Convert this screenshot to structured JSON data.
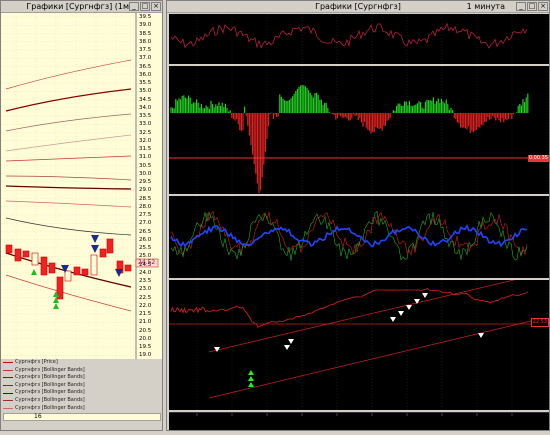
{
  "left_window": {
    "title": "Графики [Сургнфгз] (1м...",
    "price_axis": [
      "39.5",
      "39.0",
      "38.5",
      "38.0",
      "37.5",
      "37.0",
      "36.5",
      "36.0",
      "35.5",
      "35.0",
      "34.5",
      "34.0",
      "33.5",
      "33.0",
      "32.5",
      "32.0",
      "31.5",
      "31.0",
      "30.5",
      "30.0",
      "29.5",
      "29.0",
      "28.5",
      "28.0",
      "27.5",
      "27.0",
      "26.5",
      "26.0",
      "25.5",
      "25.0",
      "24.5",
      "24.0",
      "23.5",
      "23.0",
      "22.5",
      "22.0",
      "21.5",
      "21.0",
      "20.5",
      "20.0",
      "19.5",
      "19.0"
    ],
    "price_tag": "24.52",
    "legend": [
      {
        "text": "Сургнфгз [Price]",
        "color": "#cc0000"
      },
      {
        "text": "Сургнфгз [Bollinger Bands]",
        "color": "#cc3333"
      },
      {
        "text": "Сургнфгз [Bollinger Bands]",
        "color": "#990000"
      },
      {
        "text": "Сургнфгз [Bollinger Bands]",
        "color": "#cc0000"
      },
      {
        "text": "Сургнфгз [Bollinger Bands]",
        "color": "#660000"
      },
      {
        "text": "Сургнфгз [Bollinger Bands]",
        "color": "#993333"
      },
      {
        "text": "Сургнфгз [Bollinger Bands]",
        "color": "#cc6666"
      }
    ],
    "footer_value": "16"
  },
  "right_window": {
    "title": "Графики [Сургнфгз]",
    "timeframe": "1 минута",
    "panel2_tag": "0.00.35",
    "panel4_tag": "22.53"
  }
}
